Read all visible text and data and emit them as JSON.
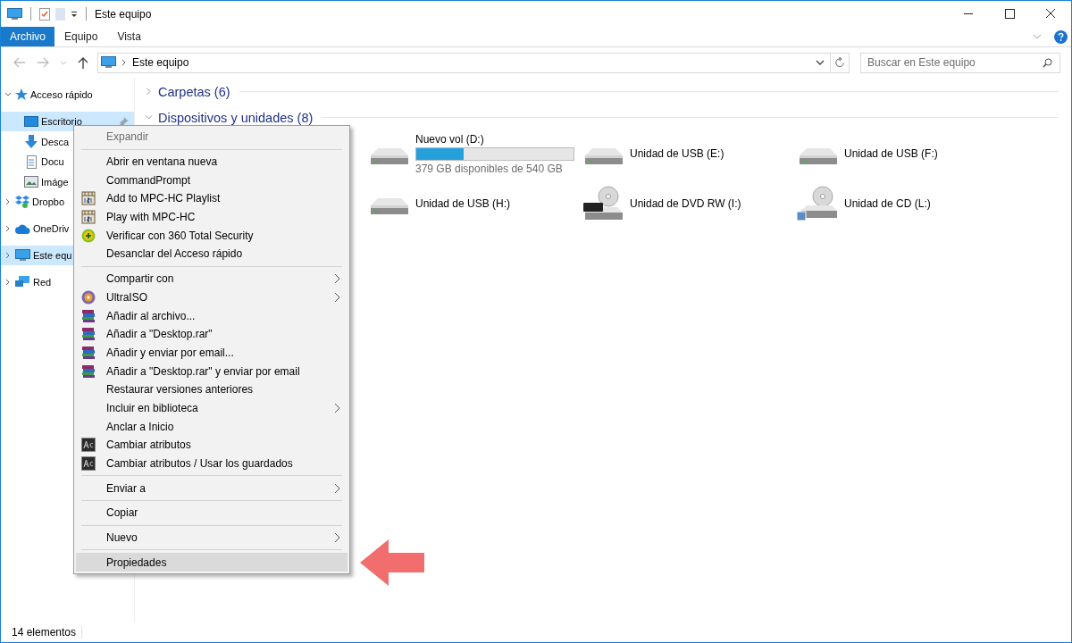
{
  "window": {
    "title": "Este equipo"
  },
  "ribbon": {
    "tabs": [
      {
        "label": "Archivo",
        "kind": "file"
      },
      {
        "label": "Equipo",
        "kind": "tab"
      },
      {
        "label": "Vista",
        "kind": "tab"
      }
    ]
  },
  "address": {
    "path": "Este equipo"
  },
  "search": {
    "placeholder": "Buscar en Este equipo"
  },
  "sidebar": {
    "items": [
      {
        "label": "Acceso rápido",
        "kind": "star",
        "expanded": true,
        "selected": false,
        "children": [
          {
            "label": "Escritorio",
            "kind": "desktop",
            "selected": true,
            "pinned": true
          },
          {
            "label": "Desca",
            "kind": "download",
            "selected": false,
            "pinned": false
          },
          {
            "label": "Docu",
            "kind": "document",
            "selected": false,
            "pinned": false
          },
          {
            "label": "Imáge",
            "kind": "pictures",
            "selected": false,
            "pinned": false
          }
        ]
      },
      {
        "label": "Dropbo",
        "kind": "dropbox",
        "expanded": false,
        "selected": false
      },
      {
        "label": "OneDriv",
        "kind": "cloud",
        "expanded": false,
        "selected": false
      },
      {
        "label": "Este equ",
        "kind": "computer",
        "expanded": false,
        "selected": true
      },
      {
        "label": "Red",
        "kind": "network",
        "expanded": false,
        "selected": false
      }
    ]
  },
  "content": {
    "groups": [
      {
        "title": "Carpetas (6)",
        "expanded": false
      },
      {
        "title": "Dispositivos y unidades (8)",
        "expanded": true,
        "drives": [
          {
            "name": "Nuevo vol (D:)",
            "kind": "disk",
            "level": 0.3,
            "free": "379 GB disponibles de 540 GB"
          },
          {
            "name": "Unidad de USB (E:)",
            "kind": "disk"
          },
          {
            "name": "Unidad de USB (F:)",
            "kind": "disk"
          },
          {
            "name": "Unidad de USB (H:)",
            "kind": "disk"
          },
          {
            "name": "Unidad de DVD RW (I:)",
            "kind": "dvd"
          },
          {
            "name": "Unidad de CD (L:)",
            "kind": "cd"
          }
        ]
      }
    ]
  },
  "context_menu": {
    "groups": [
      [
        {
          "label": "Expandir",
          "kind": "plain",
          "disabled": true,
          "submenu": false,
          "selected": false
        }
      ],
      [
        {
          "label": "Abrir en ventana nueva",
          "kind": "plain",
          "disabled": false,
          "submenu": false,
          "selected": false
        },
        {
          "label": "CommandPrompt",
          "kind": "plain",
          "disabled": false,
          "submenu": false,
          "selected": false
        },
        {
          "label": "Add to MPC-HC Playlist",
          "kind": "film",
          "disabled": false,
          "submenu": false,
          "selected": false
        },
        {
          "label": "Play with MPC-HC",
          "kind": "film",
          "disabled": false,
          "submenu": false,
          "selected": false
        },
        {
          "label": "Verificar con 360 Total Security",
          "kind": "plus",
          "disabled": false,
          "submenu": false,
          "selected": false
        },
        {
          "label": "Desanclar del Acceso rápido",
          "kind": "plain",
          "disabled": false,
          "submenu": false,
          "selected": false
        }
      ],
      [
        {
          "label": "Compartir con",
          "kind": "plain",
          "disabled": false,
          "submenu": true,
          "selected": false
        },
        {
          "label": "UltraISO",
          "kind": "disc",
          "disabled": false,
          "submenu": true,
          "selected": false
        },
        {
          "label": "Añadir al archivo...",
          "kind": "books",
          "disabled": false,
          "submenu": false,
          "selected": false
        },
        {
          "label": "Añadir a \"Desktop.rar\"",
          "kind": "books",
          "disabled": false,
          "submenu": false,
          "selected": false
        },
        {
          "label": "Añadir y enviar por email...",
          "kind": "books",
          "disabled": false,
          "submenu": false,
          "selected": false
        },
        {
          "label": "Añadir a \"Desktop.rar\" y enviar por email",
          "kind": "books",
          "disabled": false,
          "submenu": false,
          "selected": false
        },
        {
          "label": "Restaurar versiones anteriores",
          "kind": "plain",
          "disabled": false,
          "submenu": false,
          "selected": false
        },
        {
          "label": "Incluir en biblioteca",
          "kind": "plain",
          "disabled": false,
          "submenu": true,
          "selected": false
        },
        {
          "label": "Anclar a Inicio",
          "kind": "plain",
          "disabled": false,
          "submenu": false,
          "selected": false
        },
        {
          "label": "Cambiar atributos",
          "kind": "dark",
          "disabled": false,
          "submenu": false,
          "selected": false
        },
        {
          "label": "Cambiar atributos / Usar los guardados",
          "kind": "dark",
          "disabled": false,
          "submenu": false,
          "selected": false
        }
      ],
      [
        {
          "label": "Enviar a",
          "kind": "plain",
          "disabled": false,
          "submenu": true,
          "selected": false
        }
      ],
      [
        {
          "label": "Copiar",
          "kind": "plain",
          "disabled": false,
          "submenu": false,
          "selected": false
        }
      ],
      [
        {
          "label": "Nuevo",
          "kind": "plain",
          "disabled": false,
          "submenu": true,
          "selected": false
        }
      ],
      [
        {
          "label": "Propiedades",
          "kind": "plain",
          "disabled": false,
          "submenu": false,
          "selected": true
        }
      ]
    ]
  },
  "status_bar": {
    "count": "14 elementos"
  }
}
